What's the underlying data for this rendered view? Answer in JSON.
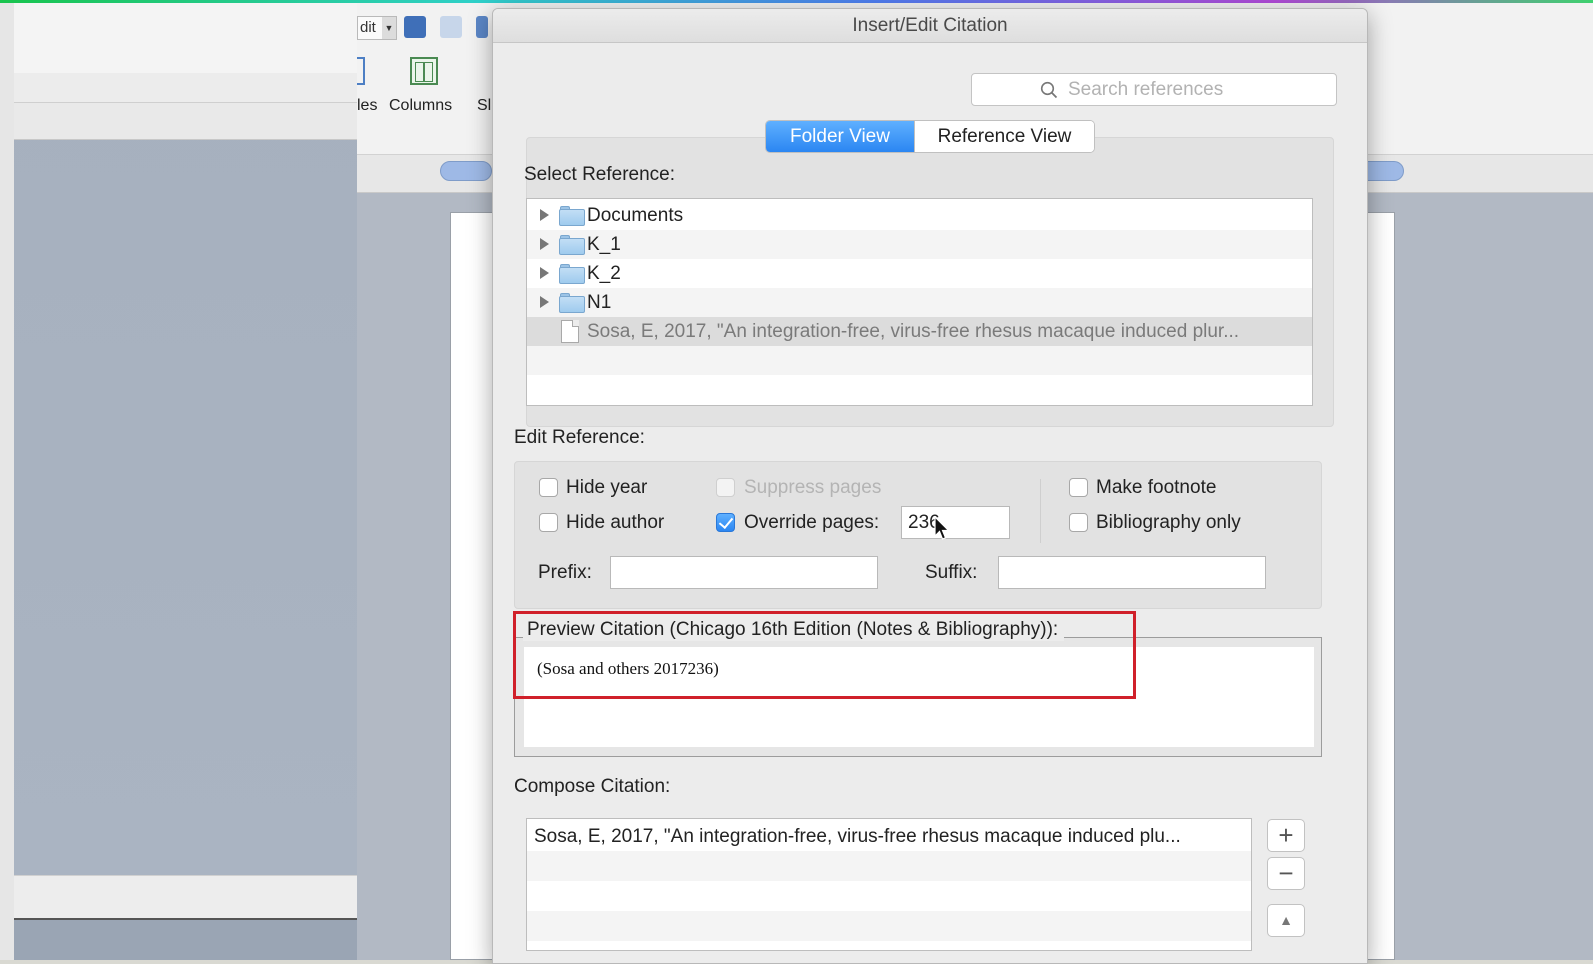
{
  "background": {
    "toolbar": {
      "combo_text": "dit",
      "label_left": "les",
      "label_columns": "Columns",
      "label_right": "Sl"
    }
  },
  "dialog": {
    "title": "Insert/Edit Citation",
    "search": {
      "placeholder": "Search references",
      "value": ""
    },
    "view_toggle": {
      "folder_view": "Folder View",
      "reference_view": "Reference View",
      "active": "Folder View"
    },
    "select_reference": {
      "label": "Select Reference:",
      "items": [
        {
          "type": "folder",
          "name": "Documents"
        },
        {
          "type": "folder",
          "name": "K_1"
        },
        {
          "type": "folder",
          "name": "K_2"
        },
        {
          "type": "folder",
          "name": "N1"
        },
        {
          "type": "reference",
          "name": "Sosa, E, 2017, \"An integration-free, virus-free rhesus macaque induced plur..."
        }
      ]
    },
    "edit_reference": {
      "label": "Edit Reference:",
      "hide_year": {
        "label": "Hide year",
        "checked": false
      },
      "hide_author": {
        "label": "Hide author",
        "checked": false
      },
      "suppress_pages": {
        "label": "Suppress pages",
        "checked": false,
        "disabled": true
      },
      "override_pages": {
        "label": "Override pages:",
        "checked": true,
        "value": "236"
      },
      "make_footnote": {
        "label": "Make footnote",
        "checked": false
      },
      "bibliography_only": {
        "label": "Bibliography only",
        "checked": false
      },
      "prefix": {
        "label": "Prefix:",
        "value": ""
      },
      "suffix": {
        "label": "Suffix:",
        "value": ""
      }
    },
    "preview": {
      "label": "Preview Citation (Chicago 16th Edition (Notes & Bibliography)):",
      "text": "(Sosa and others 2017236)"
    },
    "compose": {
      "label": "Compose Citation:",
      "items": [
        "Sosa, E, 2017, \"An integration-free, virus-free rhesus macaque induced plu..."
      ],
      "add_button": "+",
      "remove_button": "−",
      "move_up_button": "▲"
    }
  },
  "colors": {
    "accent": "#2b86f2",
    "highlight": "#d0202a"
  }
}
